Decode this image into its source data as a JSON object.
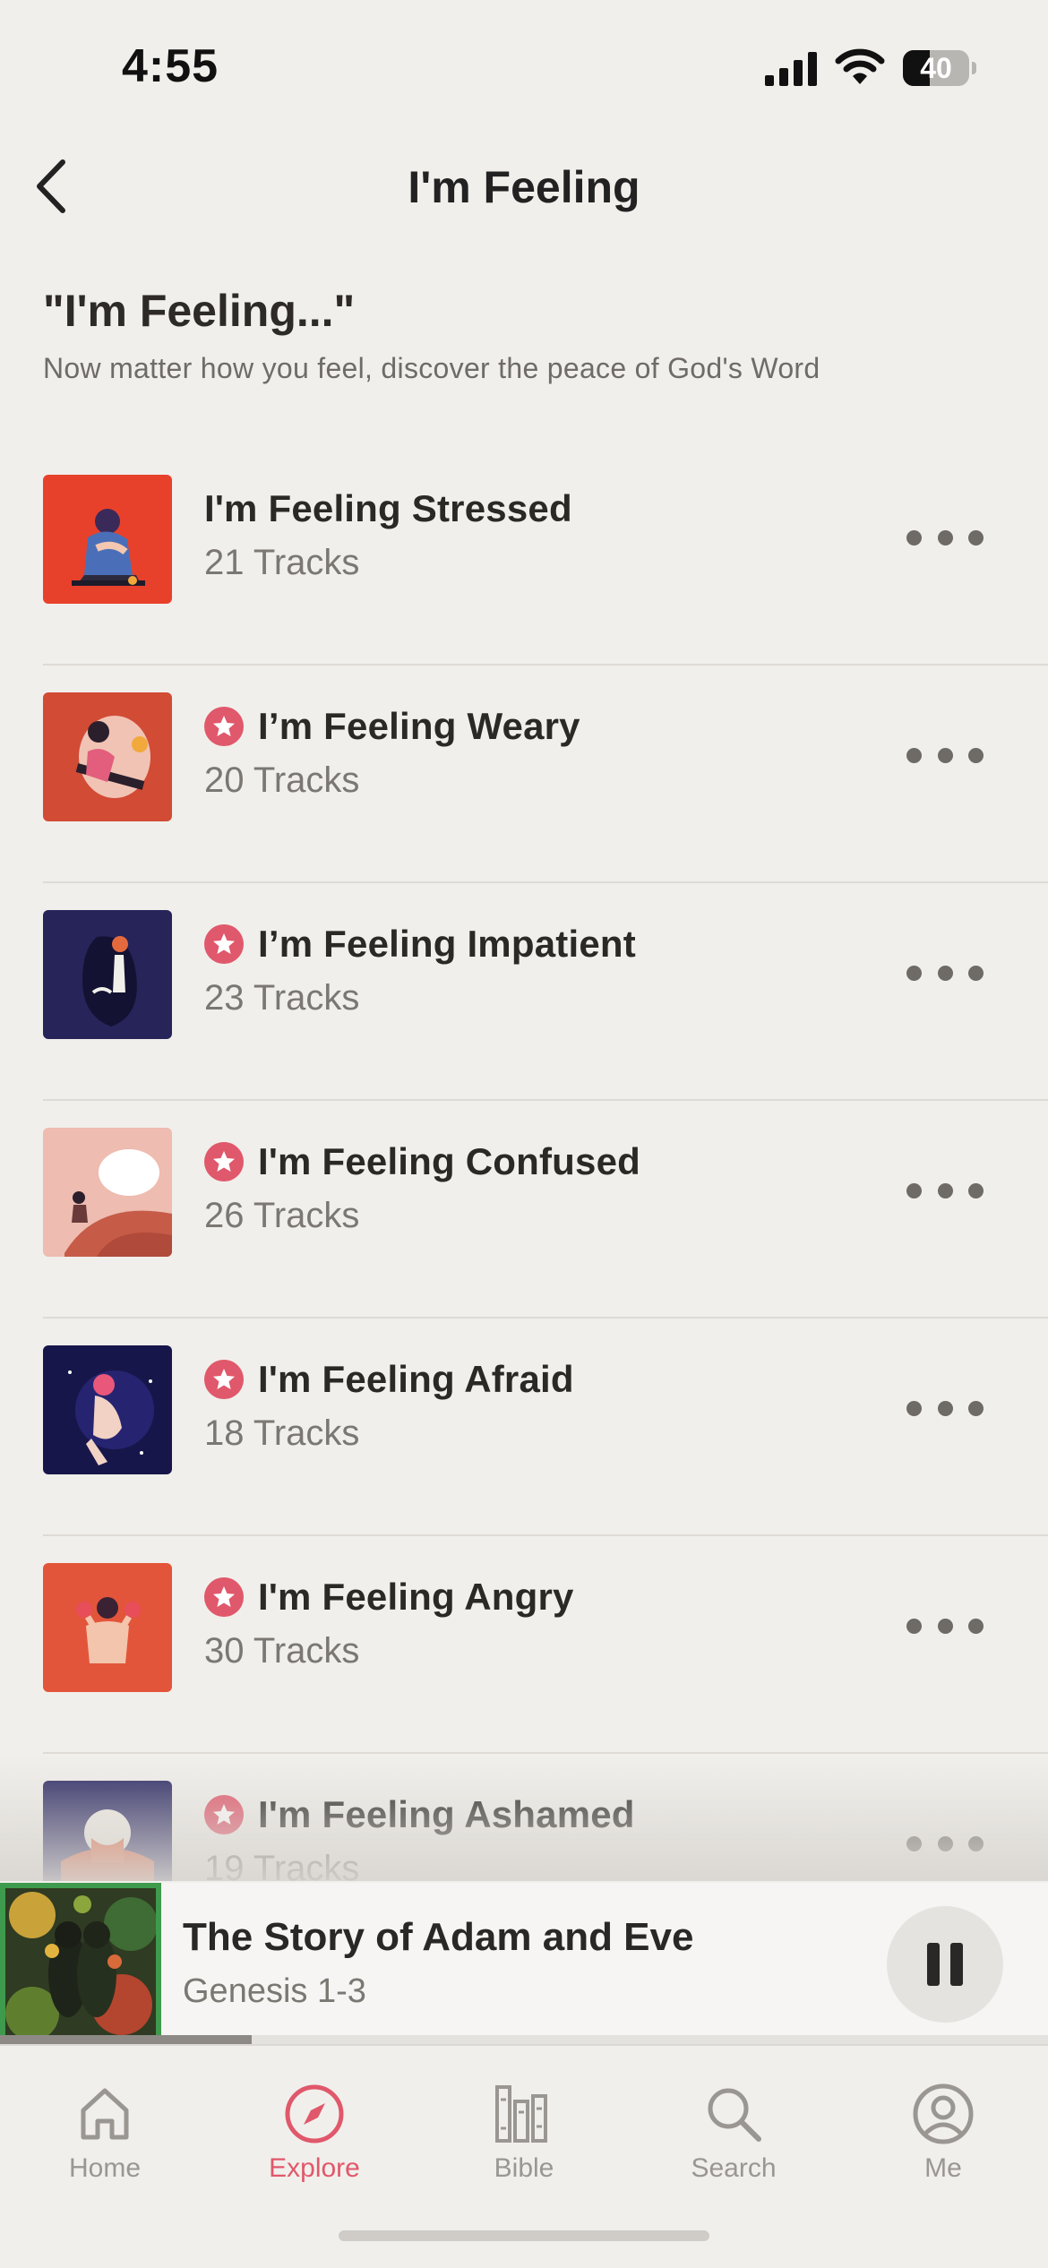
{
  "status_bar": {
    "time": "4:55",
    "battery_level": "40",
    "battery_fraction": 0.4,
    "icons": [
      "cellular-signal-icon",
      "wifi-icon",
      "battery-icon"
    ]
  },
  "nav": {
    "title": "I'm Feeling",
    "back_icon": "chevron-left-icon"
  },
  "header": {
    "title": "\"I'm Feeling...\"",
    "subtitle": "Now matter how you feel, discover the peace of God's Word"
  },
  "colors": {
    "accent": "#e0586b",
    "background": "#f1efeb",
    "text_primary": "#2b2926",
    "text_secondary": "#7b7773",
    "now_playing_border": "#3e9a4c"
  },
  "playlists": [
    {
      "title": "I'm Feeling Stressed",
      "tracks": "21 Tracks",
      "premium": false,
      "art_bg": "#e8412b"
    },
    {
      "title": "I’m Feeling Weary",
      "tracks": "20 Tracks",
      "premium": true,
      "art_bg": "#d24b35"
    },
    {
      "title": "I’m Feeling Impatient",
      "tracks": "23 Tracks",
      "premium": true,
      "art_bg": "#27245a"
    },
    {
      "title": "I'm Feeling Confused",
      "tracks": "26 Tracks",
      "premium": true,
      "art_bg": "#eebcb0"
    },
    {
      "title": "I'm Feeling Afraid",
      "tracks": "18 Tracks",
      "premium": true,
      "art_bg": "#17164a"
    },
    {
      "title": "I'm Feeling Angry",
      "tracks": "30 Tracks",
      "premium": true,
      "art_bg": "#e3553a"
    },
    {
      "title": "I'm Feeling Ashamed",
      "tracks": "19 Tracks",
      "premium": true,
      "art_bg": "#2e2c66"
    }
  ],
  "now_playing": {
    "title": "The Story of Adam and Eve",
    "subtitle": "Genesis 1-3",
    "progress": 0.24,
    "control_icon": "pause-icon"
  },
  "tabs": [
    {
      "label": "Home",
      "icon": "home-icon",
      "active": false
    },
    {
      "label": "Explore",
      "icon": "compass-icon",
      "active": true
    },
    {
      "label": "Bible",
      "icon": "bible-books-icon",
      "active": false
    },
    {
      "label": "Search",
      "icon": "search-icon",
      "active": false
    },
    {
      "label": "Me",
      "icon": "profile-icon",
      "active": false
    }
  ]
}
